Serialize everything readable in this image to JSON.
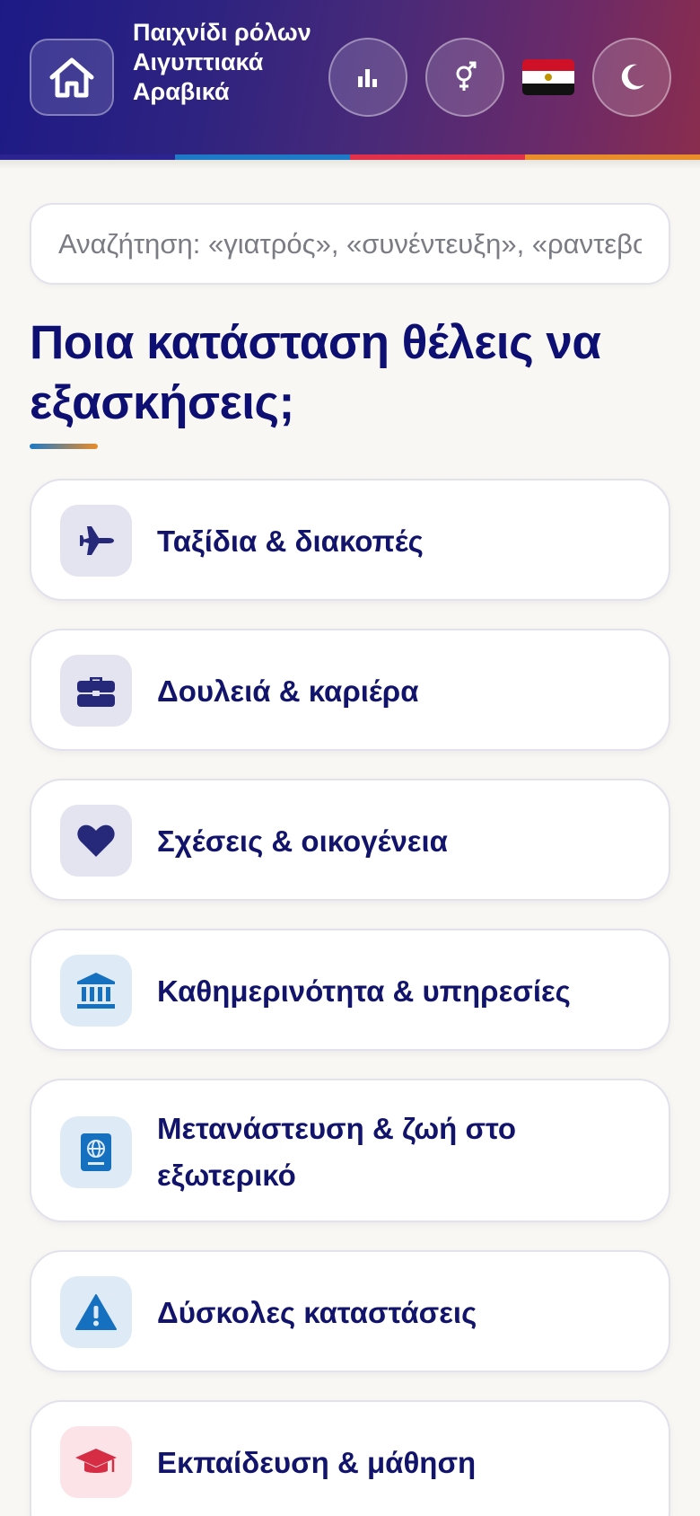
{
  "header": {
    "title": "Παιχνίδι ρόλων Αιγυπτιακά Αραβικά",
    "accent_colors": [
      "#1d1a86",
      "#1e7ac6",
      "#e0304a",
      "#e98c2a"
    ],
    "buttons": {
      "home_icon": "home-icon",
      "stats_icon": "bar-chart-icon",
      "gender_icon": "gender-icon",
      "language_flag": "egypt-flag",
      "theme_icon": "moon-icon"
    }
  },
  "search": {
    "placeholder": "Αναζήτηση: «γιατρός», «συνέντευξη», «ραντεβού»"
  },
  "main": {
    "heading": "Ποια κατάσταση θέλεις να εξασκήσεις;",
    "categories": [
      {
        "label": "Ταξίδια & διακοπές",
        "icon": "airplane-icon",
        "icon_color": "#26287a",
        "icon_bg": "#e4e3f0"
      },
      {
        "label": "Δουλειά & καριέρα",
        "icon": "briefcase-icon",
        "icon_color": "#26287a",
        "icon_bg": "#e4e3f0"
      },
      {
        "label": "Σχέσεις & οικογένεια",
        "icon": "heart-icon",
        "icon_color": "#26287a",
        "icon_bg": "#e4e3f0"
      },
      {
        "label": "Καθημερινότητα & υπηρεσίες",
        "icon": "bank-icon",
        "icon_color": "#1570c0",
        "icon_bg": "#dfeaf7"
      },
      {
        "label": "Μετανάστευση & ζωή στο εξωτερικό",
        "icon": "passport-icon",
        "icon_color": "#1570c0",
        "icon_bg": "#dfeaf7"
      },
      {
        "label": "Δύσκολες καταστάσεις",
        "icon": "warning-icon",
        "icon_color": "#1570c0",
        "icon_bg": "#dfeaf7"
      },
      {
        "label": "Εκπαίδευση & μάθηση",
        "icon": "graduation-cap-icon",
        "icon_color": "#d62d45",
        "icon_bg": "#fbe3e7"
      }
    ]
  }
}
